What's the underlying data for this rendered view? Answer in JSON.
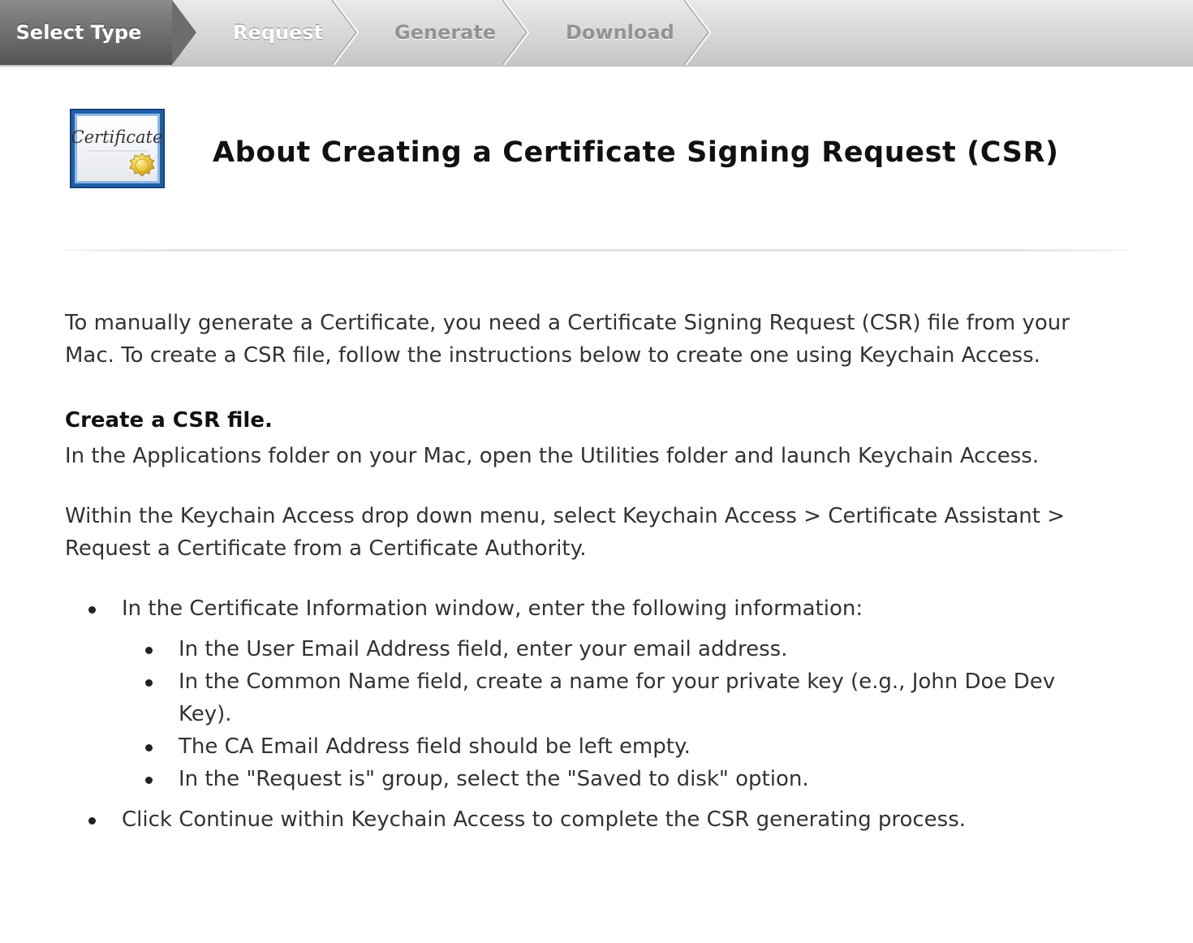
{
  "steps": [
    {
      "label": "Select Type",
      "state": "active"
    },
    {
      "label": "Request",
      "state": "next"
    },
    {
      "label": "Generate",
      "state": "upcoming"
    },
    {
      "label": "Download",
      "state": "upcoming"
    }
  ],
  "header": {
    "icon": "certificate-icon",
    "icon_text": "Certificate",
    "title": "About Creating a Certificate Signing Request (CSR)"
  },
  "content": {
    "intro": "To manually generate a Certificate, you need a Certificate Signing Request (CSR) file from your Mac. To create a CSR file, follow the instructions below to create one using Keychain Access.",
    "heading": "Create a CSR file.",
    "step1": "In the Applications folder on your Mac, open the Utilities folder and launch Keychain Access.",
    "step2": "Within the Keychain Access drop down menu, select Keychain Access > Certificate Assistant > Request a Certificate from a Certificate Authority.",
    "bullets": [
      "In the Certificate Information window, enter the following information:",
      "Click Continue within Keychain Access to complete the CSR generating process."
    ],
    "sub_bullets": [
      "In the User Email Address field, enter your email address.",
      "In the Common Name field, create a name for your private key (e.g., John Doe Dev Key).",
      "The CA Email Address field should be left empty.",
      "In the \"Request is\" group, select the \"Saved to disk\" option."
    ]
  },
  "colors": {
    "active_step": "#6c6c6c",
    "stepbar": "#d6d6d6",
    "icon_border": "#1f5fa8",
    "seal": "#e8c232"
  }
}
